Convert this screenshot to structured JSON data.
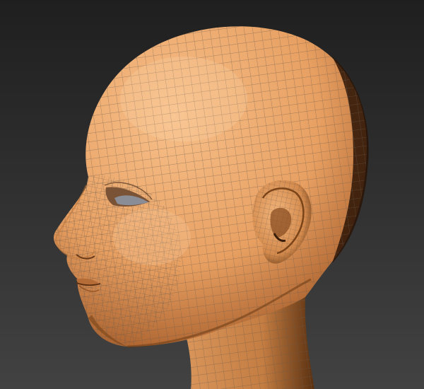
{
  "viewport": {
    "subject": "head-mesh",
    "display_mode": "smooth-shaded-with-wireframe",
    "colors": {
      "background_top": "#1f1f1f",
      "background_bottom": "#424242",
      "skin_light": "#f7c08a",
      "skin_mid": "#e8a062",
      "skin_dark": "#a85f2c",
      "shadow": "#3a1d08",
      "wire": "#6b5a4a"
    }
  }
}
